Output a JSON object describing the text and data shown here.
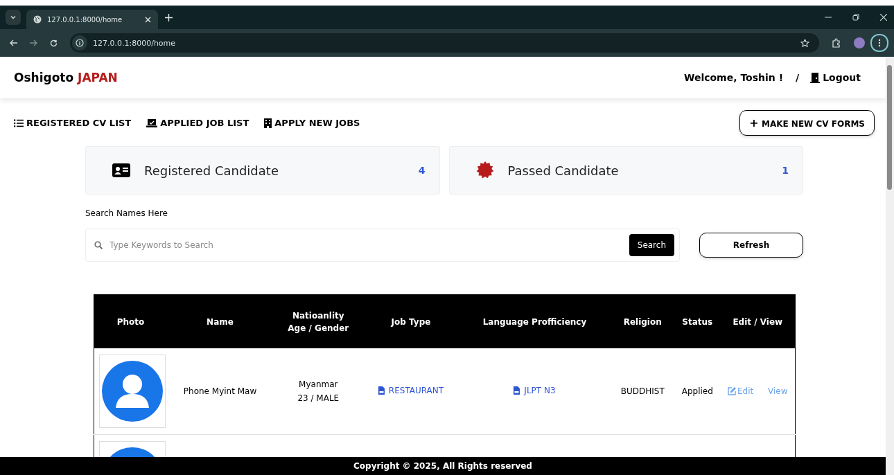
{
  "browser": {
    "tab_title": "127.0.0.1:8000/home",
    "url": "127.0.0.1:8000/home"
  },
  "header": {
    "brand": "Oshigoto",
    "brand_accent": "JAPAN",
    "welcome": "Welcome, Toshin !",
    "separator": "/",
    "logout": "Logout"
  },
  "nav": [
    {
      "label": "REGISTERED CV LIST",
      "kind": "list"
    },
    {
      "label": "APPLIED JOB LIST",
      "kind": "inbox"
    },
    {
      "label": "APPLY NEW JOBS",
      "kind": "building"
    }
  ],
  "make_button": {
    "icon": "+",
    "label": "MAKE NEW CV FORMS"
  },
  "stats": [
    {
      "label": "Registered Candidate",
      "count": "4",
      "kind": "card"
    },
    {
      "label": "Passed Candidate",
      "count": "1",
      "kind": "badge"
    }
  ],
  "search": {
    "label": "Search Names Here",
    "placeholder": "Type Keywords to Search",
    "button": "Search",
    "refresh": "Refresh"
  },
  "table": {
    "columns": [
      "Photo",
      "Name",
      "Natioanlity\nAge /  Gender",
      "Job Type",
      "Language Profficiency",
      "Religion",
      "Status",
      "Edit / View"
    ],
    "rows": [
      {
        "has_photo": true,
        "name": "Phone Myint Maw",
        "nationality": "Myanmar",
        "age_gender": "23 /  MALE",
        "job_type": "RESTAURANT",
        "language": "JLPT N3",
        "religion": "BUDDHIST",
        "status": "Applied",
        "edit": "Edit",
        "view": "View"
      },
      {
        "has_photo": true
      }
    ]
  },
  "footer": "Copyright © 2025, All Rights reserved"
}
